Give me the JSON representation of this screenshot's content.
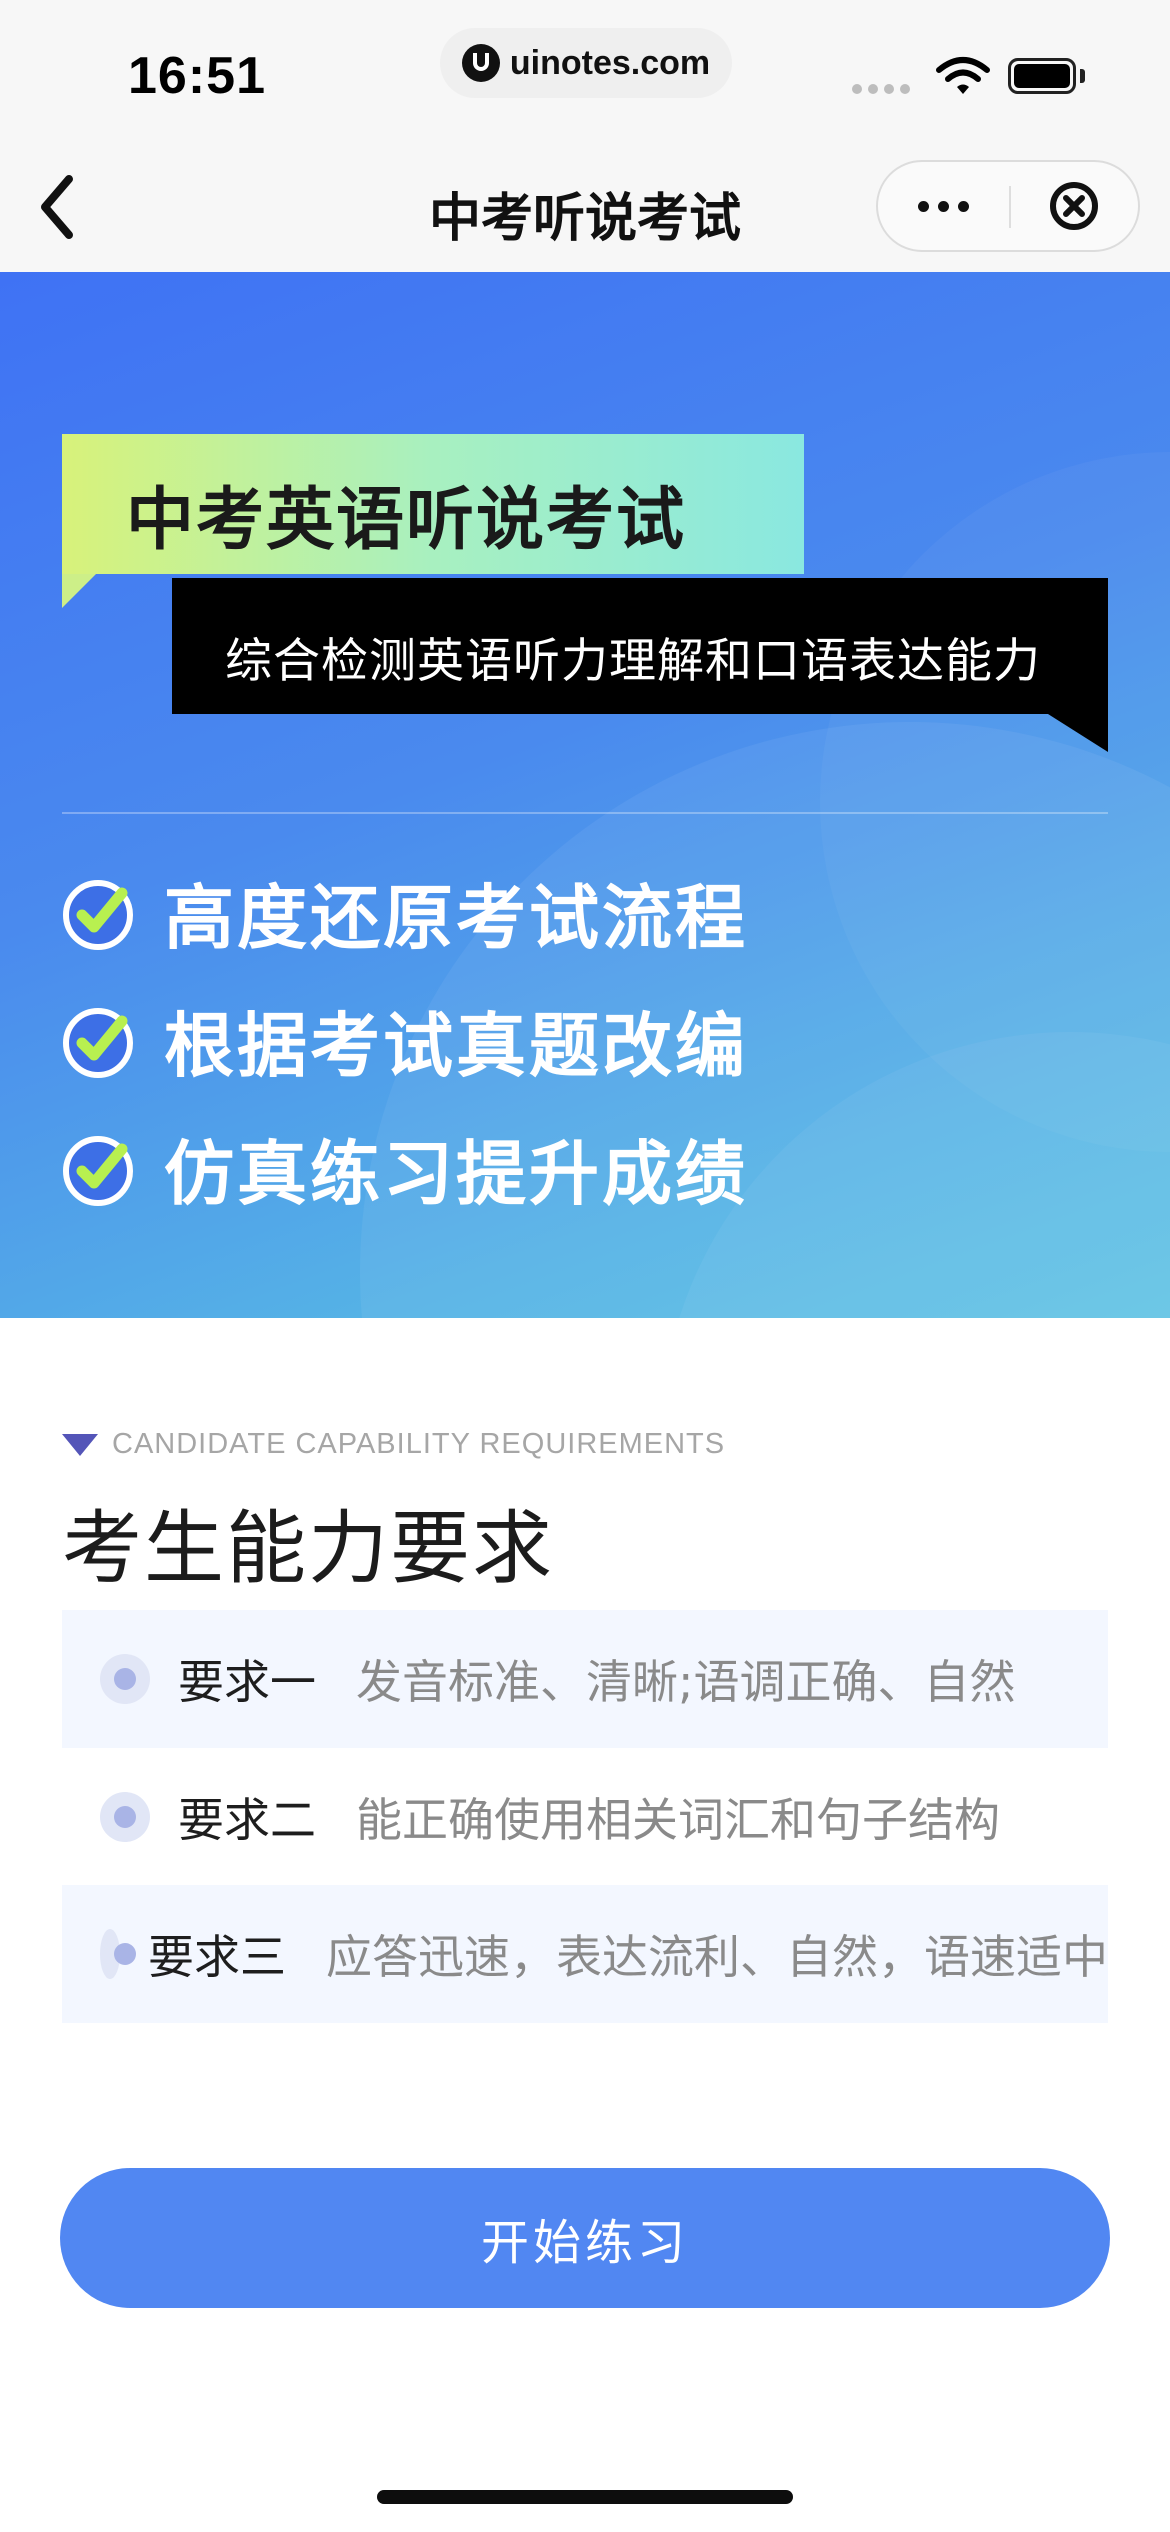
{
  "status_bar": {
    "time": "16:51",
    "url": "uinotes.com"
  },
  "nav": {
    "title": "中考听说考试"
  },
  "banner": {
    "title": "中考英语听说考试",
    "subtitle": "综合检测英语听力理解和口语表达能力",
    "features": [
      {
        "label": "高度还原考试流程"
      },
      {
        "label": "根据考试真题改编"
      },
      {
        "label": "仿真练习提升成绩"
      }
    ],
    "colors": {
      "gradient_start": "#3f72f4",
      "gradient_end": "#5dc2e4",
      "check_fill": "#b8f050"
    }
  },
  "requirements": {
    "section_en": "CANDIDATE CAPABILITY REQUIREMENTS",
    "section_title": "考生能力要求",
    "items": [
      {
        "label": "要求一",
        "text": "发音标准、清晰;语调正确、自然"
      },
      {
        "label": "要求二",
        "text": "能正确使用相关词汇和句子结构"
      },
      {
        "label": "要求三",
        "text": "应答迅速，表达流利、自然，语速适中"
      }
    ]
  },
  "start_button": {
    "label": "开始练习",
    "color": "#5187f2"
  },
  "icons": [
    "back-icon",
    "more-icon",
    "close-icon",
    "check-icon",
    "wifi-icon",
    "battery-icon"
  ]
}
